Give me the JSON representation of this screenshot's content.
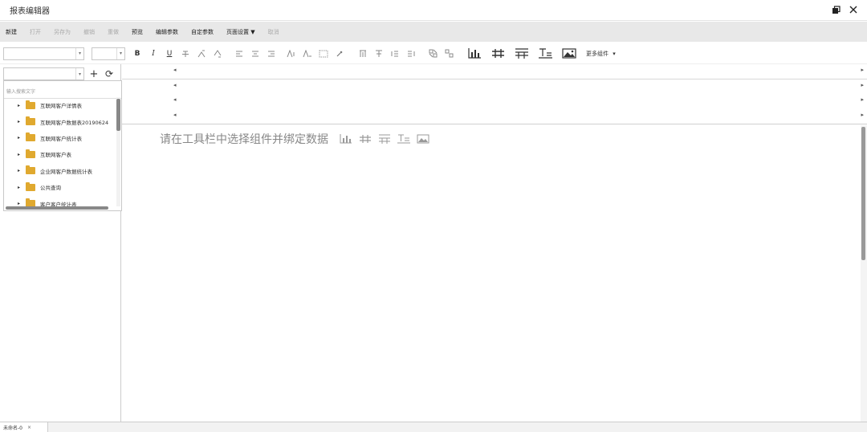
{
  "window": {
    "title": "报表编辑器",
    "restore_icon": "restore-window-icon",
    "close_icon": "close-icon"
  },
  "menu": {
    "items": [
      {
        "label": "新建",
        "enabled": true
      },
      {
        "label": "打开",
        "enabled": false
      },
      {
        "label": "另存为",
        "enabled": false
      },
      {
        "label": "撤销",
        "enabled": false
      },
      {
        "label": "重做",
        "enabled": false
      },
      {
        "label": "预览",
        "enabled": true
      },
      {
        "label": "编辑参数",
        "enabled": true
      },
      {
        "label": "自定参数",
        "enabled": true
      },
      {
        "label": "页面设置 ▼",
        "enabled": true
      },
      {
        "label": "取消",
        "enabled": false
      }
    ]
  },
  "toolbar": {
    "bold": "B",
    "italic": "I",
    "underline": "U",
    "more_label": "更多组件",
    "more_caret": "▾",
    "combo_caret": "▾"
  },
  "left_panel": {
    "add_symbol": "+",
    "refresh_symbol": "⟳",
    "search_placeholder": "输入搜索文字",
    "tree_items": [
      "互联网客户详情表",
      "互联网客户数据表20190624",
      "互联网客户统计表",
      "互联网客户表",
      "企业网客户数据统计表",
      "公共查询",
      "客户客户统计表"
    ]
  },
  "props": {
    "left_arrow": "◂",
    "right_arrow": "▸"
  },
  "canvas": {
    "hint": "请在工具栏中选择组件并绑定数据"
  },
  "statusbar": {
    "tab_label": "未命名-0",
    "tab_close": "×"
  }
}
